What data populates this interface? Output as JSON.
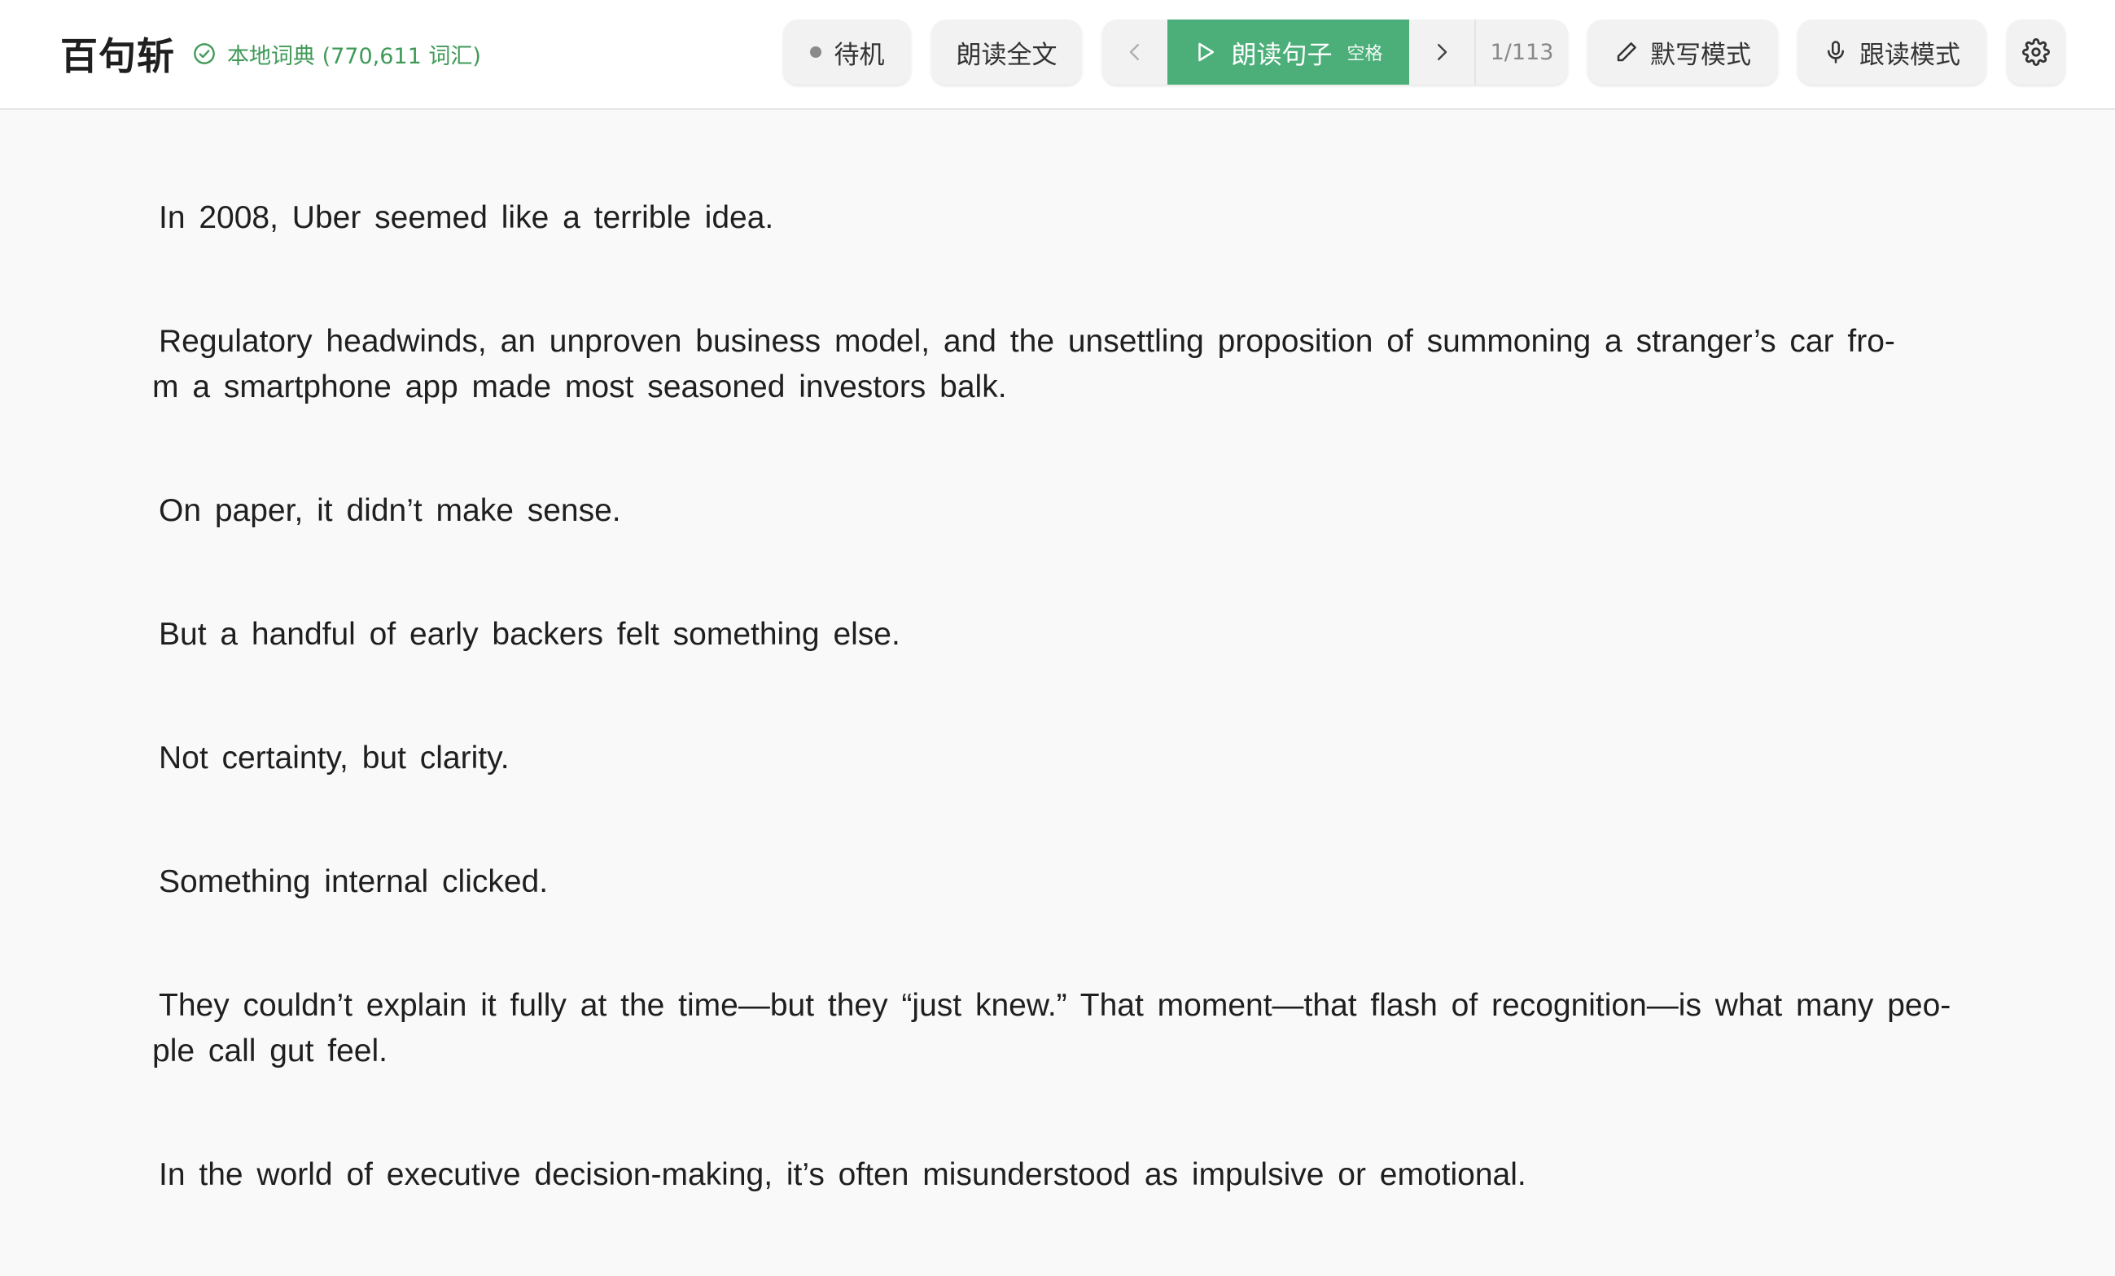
{
  "header": {
    "brand": "百句斩",
    "dict_status": "本地词典 (770,611 词汇)",
    "status_label": "待机",
    "read_all_label": "朗读全文",
    "play_sentence_label": "朗读句子",
    "play_hint": "空格",
    "counter": "1/113",
    "dictation_label": "默写模式",
    "shadowing_label": "跟读模式"
  },
  "icons": {
    "dict_status": "check-circle-icon",
    "status": "dot-icon",
    "prev": "chevron-left-icon",
    "play": "play-icon",
    "next": "chevron-right-icon",
    "dictation": "pencil-icon",
    "shadowing": "microphone-icon",
    "settings": "gear-icon"
  },
  "colors": {
    "accent": "#4caf7a",
    "dict_status": "#3f9a57",
    "background": "#f9f9f9"
  },
  "sentences": [
    {
      "lines": [
        "In 2008, Uber seemed like a terrible idea."
      ]
    },
    {
      "lines": [
        "Regulatory headwinds, an unproven business model, and the unsettling proposition of summoning a stranger’s car fro-",
        "m a smartphone app made most seasoned investors balk."
      ]
    },
    {
      "lines": [
        "On paper, it didn’t make sense."
      ]
    },
    {
      "lines": [
        "But a handful of early backers felt something else."
      ]
    },
    {
      "lines": [
        "Not certainty, but clarity."
      ]
    },
    {
      "lines": [
        "Something internal clicked."
      ]
    },
    {
      "lines": [
        "They couldn’t explain it fully at the time—but they “just knew.” That moment—that flash of recognition—is what many peo-",
        "ple call gut feel."
      ]
    },
    {
      "lines": [
        "In the world of executive decision-making, it’s often misunderstood as impulsive or emotional."
      ]
    }
  ]
}
